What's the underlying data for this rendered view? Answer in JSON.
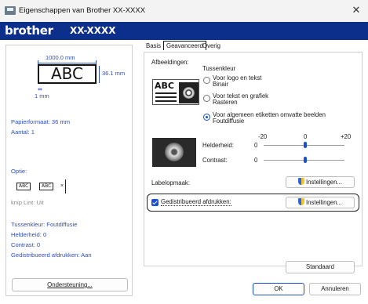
{
  "window": {
    "title": "Eigenschappen van Brother  XX-XXXX",
    "close_glyph": "✕"
  },
  "brand": {
    "logo": "brother",
    "model": "XX-XXXX"
  },
  "left_panel": {
    "preview": {
      "width_label": "1000.0 mm",
      "height_label": "36.1 mm",
      "margin_label": "1 mm",
      "label_text": "ABC"
    },
    "paper_format": "Papierformaat: 36 mm",
    "count": "Aantal: 1",
    "option_heading": "Optie:",
    "option_label_a": "ABC",
    "option_label_b": "ABC",
    "cut_status": "knip Lint: Uit",
    "halftone": "Tussenkleur: Foutdiffusie",
    "brightness": "Helderheid:  0",
    "contrast": "Contrast:  0",
    "distributed": "Gedistribueerd afdrukken: Aan",
    "support_button": "Ondersteuning..."
  },
  "tabs": [
    {
      "label": "Basis",
      "active": false
    },
    {
      "label": "Geavanceerd",
      "active": true
    },
    {
      "label": "Overig",
      "active": false
    }
  ],
  "advanced": {
    "images_heading": "Afbeeldingen:",
    "halftone_heading": "Tussenkleur",
    "image_sample_text": "ABC",
    "options": [
      {
        "line1": "Voor logo en tekst",
        "line2": "Binair",
        "selected": false
      },
      {
        "line1": "Voor tekst en grafiek",
        "line2": "Rasteren",
        "selected": false
      },
      {
        "line1": "Voor algemeen etiketten omvatte beelden",
        "line2": "Foutdiffusie",
        "selected": true
      }
    ],
    "scale": {
      "min": "-20",
      "mid": "0",
      "max": "+20"
    },
    "brightness": {
      "label": "Helderheid:",
      "value": "0",
      "level": 0
    },
    "contrast": {
      "label": "Contrast:",
      "value": "0",
      "level": 0
    },
    "label_format": {
      "label": "Labelopmaak:",
      "button": "Instellingen..."
    },
    "distributed_print": {
      "label": "Gedistribueerd afdrukken:",
      "checked": true,
      "button": "Instellingen..."
    },
    "standard_button": "Standaard"
  },
  "footer": {
    "ok": "OK",
    "cancel": "Annuleren"
  },
  "colors": {
    "brand_bar": "#0d2f8c",
    "accent": "#1b4fd1",
    "link_text": "#2d4ec0"
  }
}
